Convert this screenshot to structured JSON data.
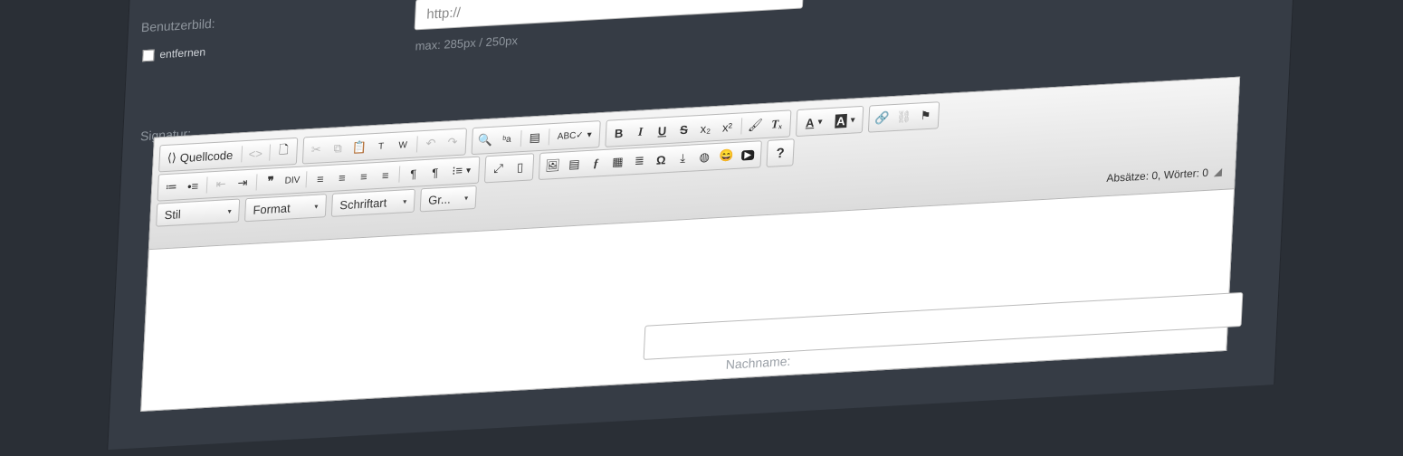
{
  "profile": {
    "user_image_label": "Benutzerbild:",
    "remove_label": "entfernen",
    "url_placeholder": "http://",
    "max_note": "max: 285px / 250px",
    "signature_label": "Signatur:",
    "lastname_label": "Nachname:"
  },
  "editor": {
    "source_label": "Quellcode",
    "style_combo": "Stil",
    "format_combo": "Format",
    "font_combo": "Schriftart",
    "size_combo": "Gr...",
    "status_text": "Absätze: 0, Wörter: 0",
    "help_label": "?"
  },
  "icons": {
    "source": "⟨⟩",
    "codesnippet": "<>",
    "newpage": "🗋",
    "cut": "✂",
    "copy": "⧉",
    "paste": "📋",
    "paste_text": "T",
    "paste_word": "W",
    "undo": "↶",
    "redo": "↷",
    "find": "🔍",
    "replace": "ᵇa",
    "selectall": "▤",
    "spellcheck": "ABC✓",
    "bold": "B",
    "italic": "I",
    "underline": "U",
    "strike": "S",
    "subscript": "x₂",
    "superscript": "x²",
    "copyformat": "🖌",
    "removeformat": "Tₓ",
    "textcolor": "A",
    "bgcolor": "A",
    "link": "🔗",
    "unlink": "⛓",
    "anchor": "⚑",
    "numlist": "≔",
    "bullist": "•≡",
    "outdent": "⇤",
    "indent": "⇥",
    "blockquote": "❞",
    "creatediv": "DIV",
    "left": "≡",
    "center": "≡",
    "right": "≡",
    "justify": "≡",
    "ltr": "¶",
    "rtl": "¶",
    "language": "⁝≡",
    "maximize": "⤢",
    "showblocks": "▯",
    "image": "🖼",
    "flash": "ƒ",
    "table": "▦",
    "hline": "≣",
    "specialchar": "Ω",
    "pagebreak": "⤓",
    "iframe": "◍",
    "smiley": "😄",
    "youtube": "▶",
    "dropdown": "▾"
  }
}
